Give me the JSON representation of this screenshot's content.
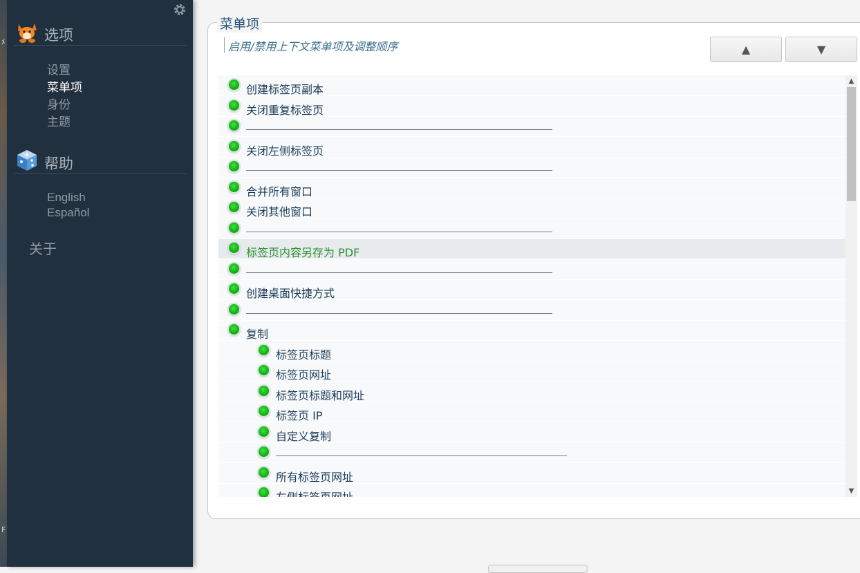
{
  "sidebar": {
    "options": {
      "title": "选项",
      "items": [
        "设置",
        "菜单项",
        "身份",
        "主题"
      ],
      "active_index": 1
    },
    "help": {
      "title": "帮助",
      "items": [
        "English",
        "Español"
      ]
    },
    "about": "关于"
  },
  "main": {
    "legend": "菜单项",
    "description": "启用/禁用上下文菜单项及调整顺序",
    "move_up": "▲",
    "move_down": "▼",
    "rows": [
      {
        "label": "创建标签页副本",
        "level": 0
      },
      {
        "label": "关闭重复标签页",
        "level": 0
      },
      {
        "label": "",
        "level": 0,
        "separator": true
      },
      {
        "label": "关闭左侧标签页",
        "level": 0
      },
      {
        "label": "",
        "level": 0,
        "separator": true
      },
      {
        "label": "合并所有窗口",
        "level": 0
      },
      {
        "label": "关闭其他窗口",
        "level": 0
      },
      {
        "label": "",
        "level": 0,
        "separator": true
      },
      {
        "label": "标签页内容另存为 PDF",
        "level": 0,
        "highlighted": true
      },
      {
        "label": "",
        "level": 0,
        "separator": true
      },
      {
        "label": "创建桌面快捷方式",
        "level": 0
      },
      {
        "label": "",
        "level": 0,
        "separator": true
      },
      {
        "label": "复制",
        "level": 0
      },
      {
        "label": "标签页标题",
        "level": 1
      },
      {
        "label": "标签页网址",
        "level": 1
      },
      {
        "label": "标签页标题和网址",
        "level": 1
      },
      {
        "label": "标签页 IP",
        "level": 1
      },
      {
        "label": "自定义复制",
        "level": 1
      },
      {
        "label": "",
        "level": 1,
        "separator": true
      },
      {
        "label": "所有标签页网址",
        "level": 1
      },
      {
        "label": "左侧标签页网址",
        "level": 1
      }
    ]
  },
  "colors": {
    "sidebar_bg": "#21303f",
    "enabled_dot": "#13b413",
    "highlight_text": "#2e8f2e",
    "label_text": "#1c3b57"
  },
  "icons": [
    "gear-icon",
    "fox-icon",
    "help-cube-icon",
    "scroll-up-icon",
    "scroll-down-icon"
  ]
}
